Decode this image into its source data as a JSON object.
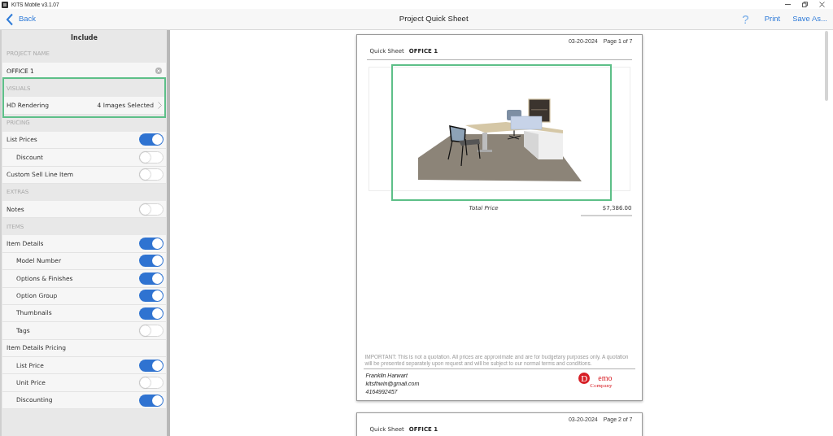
{
  "window": {
    "title": "KITS Mobile v3.1.07"
  },
  "nav_bar": {
    "back": "Back",
    "title": "Project Quick Sheet",
    "help": "?",
    "actions": [
      "Print",
      "Save As..."
    ]
  },
  "sidebar": {
    "title": "Include",
    "sections": [
      {
        "header": "PROJECT NAME",
        "highlighted": false,
        "items": [
          {
            "kind": "field",
            "value": "OFFICE 1"
          }
        ]
      },
      {
        "header": "VISUALS",
        "highlighted": true,
        "items": [
          {
            "kind": "link",
            "label": "HD Rendering",
            "value": "4 Images Selected"
          }
        ]
      },
      {
        "header": "PRICING",
        "highlighted": false,
        "items": [
          {
            "kind": "toggle",
            "label": "List Prices",
            "on": true,
            "children": [
              {
                "kind": "toggle",
                "label": "Discount",
                "on": false
              }
            ]
          },
          {
            "kind": "toggle",
            "label": "Custom Sell Line Item",
            "on": false
          }
        ]
      },
      {
        "header": "EXTRAS",
        "highlighted": false,
        "items": [
          {
            "kind": "toggle",
            "label": "Notes",
            "on": false
          }
        ]
      },
      {
        "header": "ITEMS",
        "highlighted": false,
        "items": [
          {
            "kind": "toggle",
            "label": "Item Details",
            "on": true,
            "children": [
              {
                "kind": "toggle",
                "label": "Model Number",
                "on": true
              },
              {
                "kind": "toggle",
                "label": "Options & Finishes",
                "on": true
              },
              {
                "kind": "toggle",
                "label": "Option Group",
                "on": true
              },
              {
                "kind": "toggle",
                "label": "Thumbnails",
                "on": true
              },
              {
                "kind": "toggle",
                "label": "Tags",
                "on": false
              }
            ]
          },
          {
            "kind": "label",
            "label": "Item Details Pricing",
            "children": [
              {
                "kind": "toggle",
                "label": "List Price",
                "on": true
              },
              {
                "kind": "toggle",
                "label": "Unit Price",
                "on": false
              },
              {
                "kind": "toggle",
                "label": "Discounting",
                "on": true
              }
            ]
          }
        ]
      }
    ]
  },
  "document": {
    "pages": [
      {
        "date": "03-20-2024",
        "page_label": "Page 1 of 7",
        "heading": "Quick Sheet",
        "project": "OFFICE 1",
        "rendering": {
          "highlighted": true
        },
        "total_label": "Total Price",
        "total_value": "$7,386.00",
        "disclaimer": "IMPORTANT: This is not a quotation. All prices are approximate and are for budgetary purposes only. A quotation will be presented separately upon request and will be subject to our normal terms and conditions.",
        "contact": [
          "Franklin Harwart",
          "kitsfhwin@gmail.com",
          "4164992457"
        ],
        "logo": {
          "initial": "D",
          "name": "emo",
          "tagline": "Company"
        }
      },
      {
        "date": "03-20-2024",
        "page_label": "Page 2 of 7",
        "heading": "Quick Sheet",
        "project": "OFFICE 1"
      }
    ]
  }
}
